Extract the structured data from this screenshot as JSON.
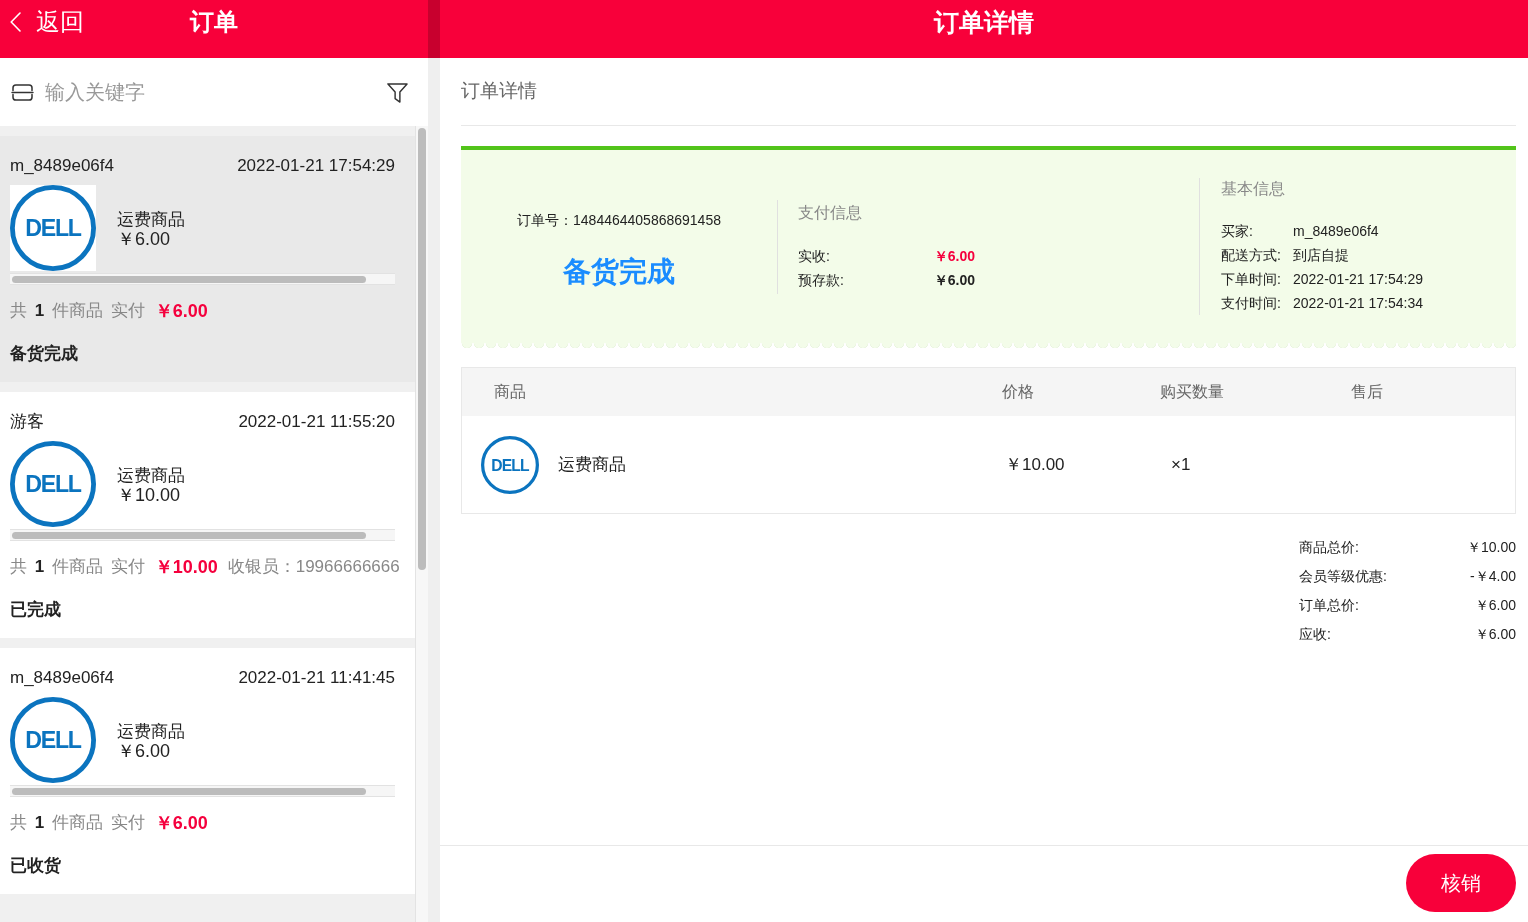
{
  "header": {
    "back_label": "返回",
    "left_title": "订单",
    "right_title": "订单详情"
  },
  "search": {
    "placeholder": "输入关键字"
  },
  "orders": [
    {
      "selected": true,
      "customer": "m_8489e06f4",
      "time": "2022-01-21 17:54:29",
      "product": {
        "logo_text": "DELL",
        "name": "运费商品",
        "price": "￥6.00"
      },
      "summary": "共 **1** 件商品 实付",
      "paid": "￥6.00",
      "status": "备货完成"
    },
    {
      "selected": false,
      "customer": "游客",
      "time": "2022-01-21 11:55:20",
      "product": {
        "logo_text": "DELL",
        "name": "运费商品",
        "price": "￥10.00"
      },
      "summary": "共 **1** 件商品 实付",
      "paid": "￥10.00",
      "cashier": "收银员：19966666666",
      "status": "已完成"
    },
    {
      "selected": false,
      "customer": "m_8489e06f4",
      "time": "2022-01-21 11:41:45",
      "product": {
        "logo_text": "DELL",
        "name": "运费商品",
        "price": "￥6.00"
      },
      "summary": "共 **1** 件商品 实付",
      "paid": "￥6.00",
      "status": "已收货"
    }
  ],
  "detail": {
    "title": "订单详情",
    "status_card": {
      "order_no": "订单号：1484464405868691458",
      "status": "备货完成",
      "payment": {
        "title": "支付信息",
        "rows": [
          {
            "kind": "highlight",
            "label": "实收:",
            "value": "￥6.00"
          },
          {
            "kind": "plain",
            "label": "预存款:",
            "value": "￥6.00"
          }
        ]
      },
      "basic": {
        "title": "基本信息",
        "rows": [
          {
            "label": "买家:",
            "value": "m_8489e06f4"
          },
          {
            "label": "配送方式:",
            "value": "到店自提"
          },
          {
            "label": "下单时间:",
            "value": "2022-01-21 17:54:29"
          },
          {
            "label": "支付时间:",
            "value": "2022-01-21 17:54:34"
          }
        ]
      }
    },
    "table": {
      "columns": [
        "商品",
        "价格",
        "购买数量",
        "售后"
      ],
      "rows": [
        {
          "logo_text": "DELL",
          "name": "运费商品",
          "price": "￥10.00",
          "quantity": "×1"
        }
      ]
    },
    "totals": [
      {
        "label": "商品总价:",
        "value": "￥10.00"
      },
      {
        "label": "会员等级优惠:",
        "value": "-￥4.00"
      },
      {
        "label": "订单总价:",
        "value": "￥6.00"
      },
      {
        "label": "应收:",
        "value": "￥6.00"
      }
    ],
    "action_button": "核销"
  }
}
